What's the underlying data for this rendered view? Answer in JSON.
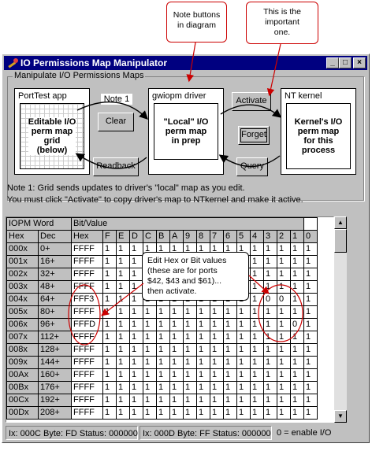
{
  "callouts": {
    "note_buttons": "Note buttons\nin diagram",
    "important": "This is the\nimportant\none.",
    "edit_values": "Edit Hex or Bit values\n(these are for ports\n$42, $43 and $61)...\nthen activate."
  },
  "window": {
    "title": "IO Permissions Map Manipulator",
    "min": "_",
    "max": "□",
    "close": "×"
  },
  "group": {
    "label": "Manipulate I/O Permissions Maps",
    "porttest": {
      "title": "PortTest app",
      "body": "Editable I/O\nperm map\ngrid\n(below)"
    },
    "driver": {
      "title": "gwiopm driver",
      "body": "\"Local\" I/O\nperm map\nin prep"
    },
    "kernel": {
      "title": "NT kernel",
      "body": "Kernel's I/O\nperm map\nfor this\nprocess"
    },
    "buttons": {
      "note1": "Note 1",
      "clear": "Clear",
      "readback": "Readback",
      "activate": "Activate",
      "forget": "Forget",
      "query": "Query"
    },
    "note_line1": "Note 1: Grid sends updates to driver's \"local\" map as you edit.",
    "note_line2": "You must click \"Activate\" to copy driver's map to NTkernel and make it active."
  },
  "grid": {
    "header_top": [
      "IOPM Word",
      "",
      "Bit/Value"
    ],
    "header_cols": [
      "Hex",
      "Dec",
      "Hex",
      "F",
      "E",
      "D",
      "C",
      "B",
      "A",
      "9",
      "8",
      "7",
      "6",
      "5",
      "4",
      "3",
      "2",
      "1",
      "0"
    ],
    "rows": [
      [
        "000x",
        "0+",
        "FFFF",
        "1",
        "1",
        "1",
        "1",
        "1",
        "1",
        "1",
        "1",
        "1",
        "1",
        "1",
        "1",
        "1",
        "1",
        "1",
        "1"
      ],
      [
        "001x",
        "16+",
        "FFFF",
        "1",
        "1",
        "1",
        "1",
        "1",
        "1",
        "1",
        "1",
        "1",
        "1",
        "1",
        "1",
        "1",
        "1",
        "1",
        "1"
      ],
      [
        "002x",
        "32+",
        "FFFF",
        "1",
        "1",
        "1",
        "1",
        "1",
        "1",
        "1",
        "1",
        "1",
        "1",
        "1",
        "1",
        "1",
        "1",
        "1",
        "1"
      ],
      [
        "003x",
        "48+",
        "FFFF",
        "1",
        "1",
        "1",
        "1",
        "1",
        "1",
        "1",
        "1",
        "1",
        "1",
        "1",
        "1",
        "1",
        "1",
        "1",
        "1"
      ],
      [
        "004x",
        "64+",
        "FFF3",
        "1",
        "1",
        "1",
        "1",
        "1",
        "1",
        "1",
        "1",
        "1",
        "1",
        "1",
        "1",
        "0",
        "0",
        "1",
        "1"
      ],
      [
        "005x",
        "80+",
        "FFFF",
        "1",
        "1",
        "1",
        "1",
        "1",
        "1",
        "1",
        "1",
        "1",
        "1",
        "1",
        "1",
        "1",
        "1",
        "1",
        "1"
      ],
      [
        "006x",
        "96+",
        "FFFD",
        "1",
        "1",
        "1",
        "1",
        "1",
        "1",
        "1",
        "1",
        "1",
        "1",
        "1",
        "1",
        "1",
        "1",
        "0",
        "1"
      ],
      [
        "007x",
        "112+",
        "FFFF",
        "1",
        "1",
        "1",
        "1",
        "1",
        "1",
        "1",
        "1",
        "1",
        "1",
        "1",
        "1",
        "1",
        "1",
        "1",
        "1"
      ],
      [
        "008x",
        "128+",
        "FFFF",
        "1",
        "1",
        "1",
        "1",
        "1",
        "1",
        "1",
        "1",
        "1",
        "1",
        "1",
        "1",
        "1",
        "1",
        "1",
        "1"
      ],
      [
        "009x",
        "144+",
        "FFFF",
        "1",
        "1",
        "1",
        "1",
        "1",
        "1",
        "1",
        "1",
        "1",
        "1",
        "1",
        "1",
        "1",
        "1",
        "1",
        "1"
      ],
      [
        "00Ax",
        "160+",
        "FFFF",
        "1",
        "1",
        "1",
        "1",
        "1",
        "1",
        "1",
        "1",
        "1",
        "1",
        "1",
        "1",
        "1",
        "1",
        "1",
        "1"
      ],
      [
        "00Bx",
        "176+",
        "FFFF",
        "1",
        "1",
        "1",
        "1",
        "1",
        "1",
        "1",
        "1",
        "1",
        "1",
        "1",
        "1",
        "1",
        "1",
        "1",
        "1"
      ],
      [
        "00Cx",
        "192+",
        "FFFF",
        "1",
        "1",
        "1",
        "1",
        "1",
        "1",
        "1",
        "1",
        "1",
        "1",
        "1",
        "1",
        "1",
        "1",
        "1",
        "1"
      ],
      [
        "00Dx",
        "208+",
        "FFFF",
        "1",
        "1",
        "1",
        "1",
        "1",
        "1",
        "1",
        "1",
        "1",
        "1",
        "1",
        "1",
        "1",
        "1",
        "1",
        "1"
      ]
    ]
  },
  "status": {
    "seg1": "Ix: 000C Byte: FD Status: 000000",
    "seg2": "Ix: 000D Byte: FF Status: 000000",
    "hint": "0 = enable I/O"
  },
  "colors": {
    "title_bar": "#000080",
    "callout_border": "#cc0000",
    "window": "#c0c0c0"
  }
}
